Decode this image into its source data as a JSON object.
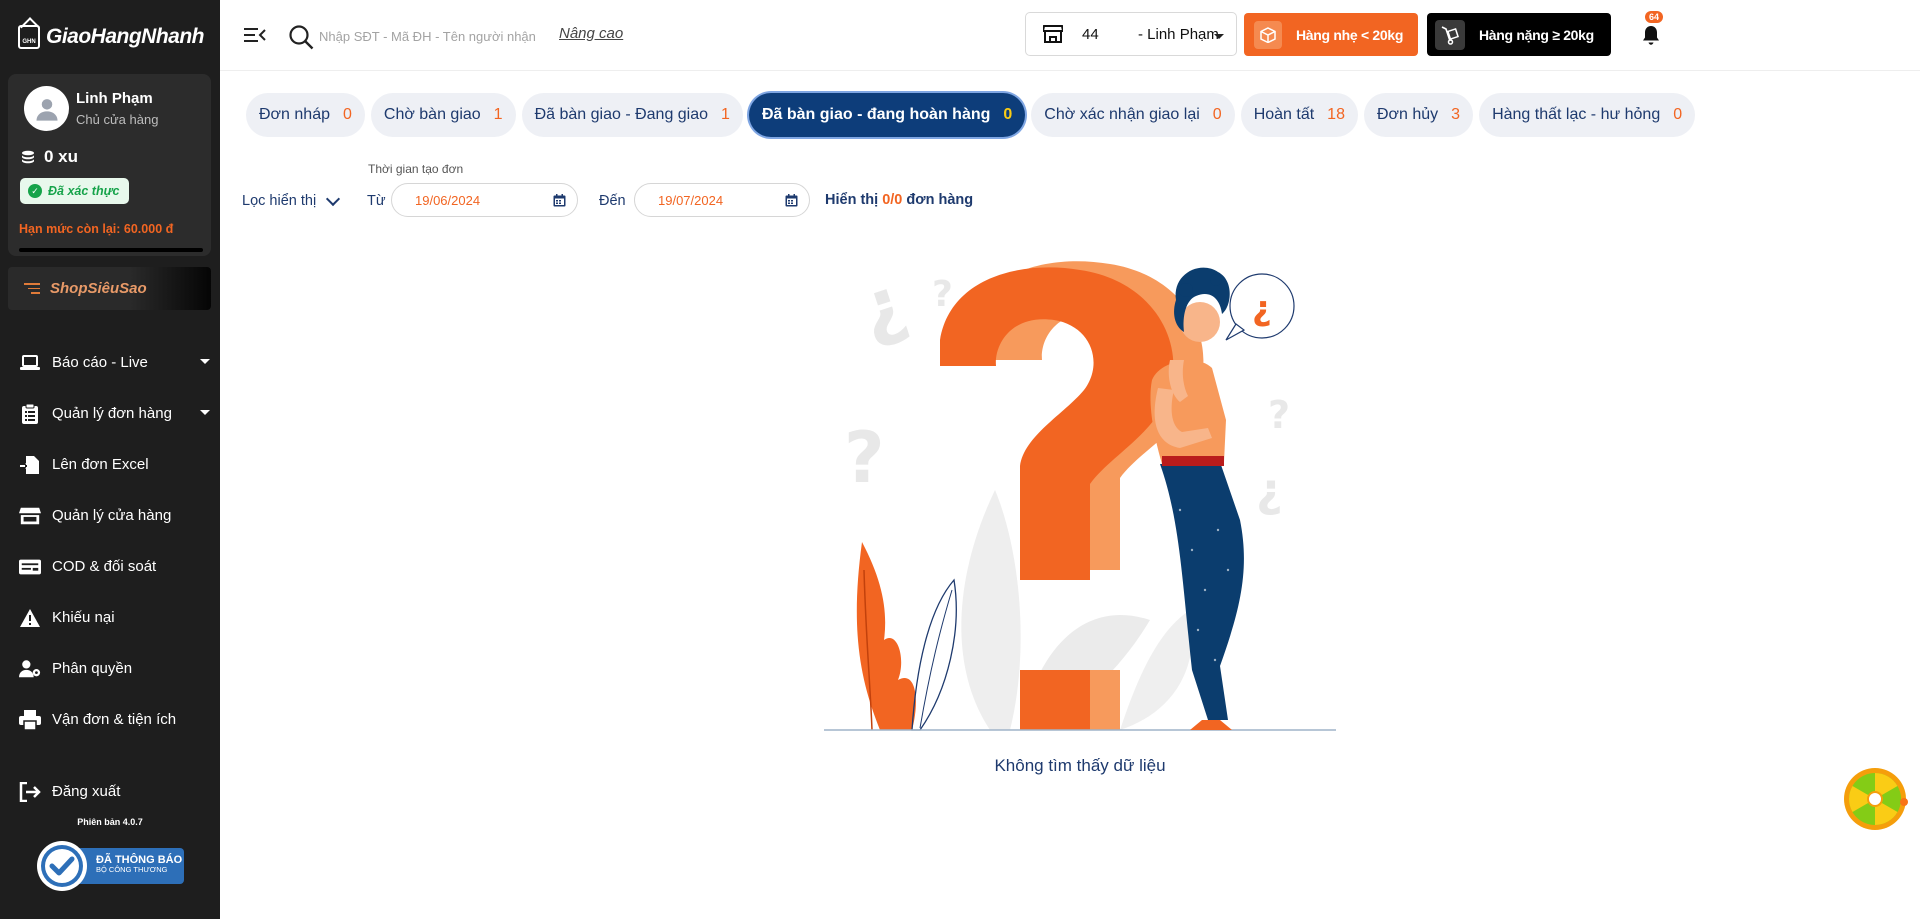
{
  "sidebar": {
    "brand": "GiaoHangNhanh",
    "brand_mark": "GHN",
    "user": {
      "name": "Linh Phạm",
      "role": "Chủ cửa hàng",
      "coins": "0 xu",
      "verified": "Đã xác thực",
      "limit": "Hạn mức còn lại: 60.000 đ"
    },
    "shop_button": "ShopSiêuSao",
    "items": [
      {
        "label": "Báo cáo - Live",
        "icon": "laptop-icon"
      },
      {
        "label": "Quản lý đơn hàng",
        "icon": "clipboard-icon"
      },
      {
        "label": "Lên đơn Excel",
        "icon": "file-import-icon"
      },
      {
        "label": "Quản lý cửa hàng",
        "icon": "store-icon"
      },
      {
        "label": "COD & đối soát",
        "icon": "money-check-icon"
      },
      {
        "label": "Khiếu nại",
        "icon": "warning-icon"
      },
      {
        "label": "Phân quyền",
        "icon": "user-gear-icon"
      },
      {
        "label": "Vận đơn & tiện ích",
        "icon": "printer-icon"
      }
    ],
    "logout": "Đăng xuất",
    "version": "Phiên bản 4.0.7",
    "certification": {
      "line1": "ĐÃ THÔNG BÁO",
      "line2": "BỘ CÔNG THƯƠNG"
    }
  },
  "topbar": {
    "search_placeholder": "Nhập SĐT - Mã ĐH - Tên người nhận",
    "advanced": "Nâng cao",
    "store_id": "44",
    "store_name": "- Linh Phạm",
    "light_button": "Hàng nhẹ < 20kg",
    "heavy_button": "Hàng nặng ≥ 20kg",
    "notifications": "64"
  },
  "tabs": [
    {
      "label": "Đơn nháp",
      "count": "0",
      "active": false
    },
    {
      "label": "Chờ bàn giao",
      "count": "1",
      "active": false
    },
    {
      "label": "Đã bàn giao - Đang giao",
      "count": "1",
      "active": false
    },
    {
      "label": "Đã bàn giao - đang hoàn hàng",
      "count": "0",
      "active": true
    },
    {
      "label": "Chờ xác nhận giao lại",
      "count": "0",
      "active": false
    },
    {
      "label": "Hoàn tất",
      "count": "18",
      "active": false
    },
    {
      "label": "Đơn hủy",
      "count": "3",
      "active": false
    },
    {
      "label": "Hàng thất lạc - hư hỏng",
      "count": "0",
      "active": false
    }
  ],
  "filters": {
    "view_filter": "Lọc hiển thị",
    "time_label": "Thời gian tạo đơn",
    "from_label": "Từ",
    "from_date": "19/06/2024",
    "to_label": "Đến",
    "to_date": "19/07/2024",
    "showing_prefix": "Hiển thị",
    "showing_count": "0/0",
    "showing_suffix": "đơn hàng"
  },
  "empty": {
    "message": "Không tìm thấy dữ liệu"
  },
  "colors": {
    "sidebar_bg": "#1e1e1e",
    "accent": "#f26522",
    "navy": "#0d3d7a",
    "tab_bg": "#eef0f5"
  }
}
